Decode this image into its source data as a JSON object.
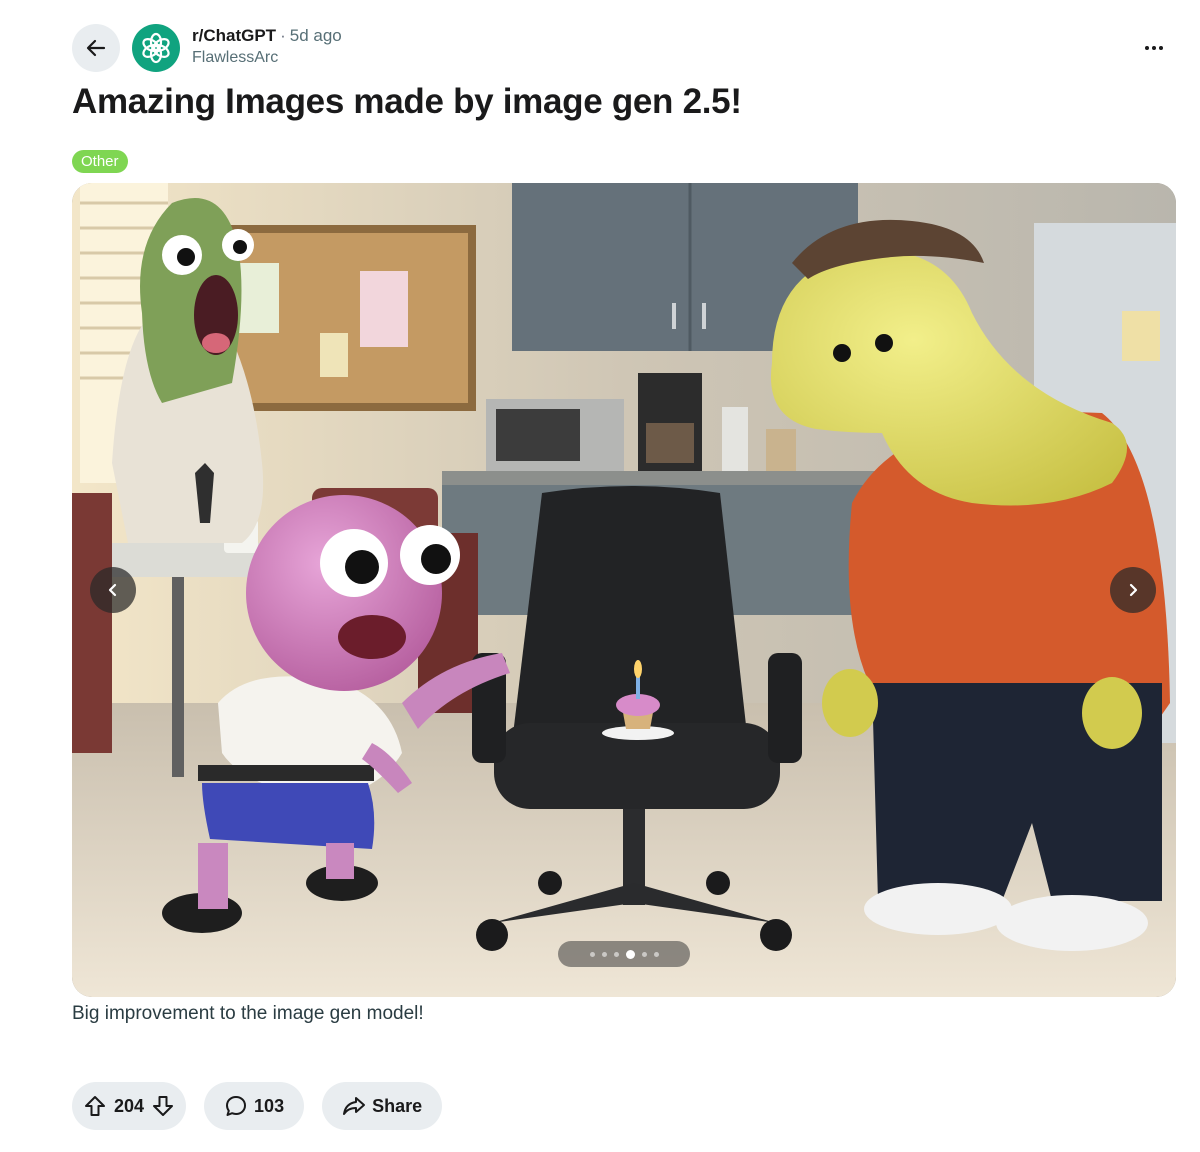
{
  "post": {
    "subreddit": "r/ChatGPT",
    "separator": "·",
    "time_ago": "5d ago",
    "author": "FlawlessArc",
    "title": "Amazing Images made by image gen 2.5!",
    "flair": "Other",
    "caption": "Big improvement to the image gen model!"
  },
  "gallery": {
    "image_description": "3D animated office break room: pink creature reaching toward an office chair holding a cupcake with a lit candle, yellow character in orange hoodie and brown cap, green character screaming in background",
    "slide_count": 6,
    "active_slide": 4
  },
  "actions": {
    "upvotes": "204",
    "comments": "103",
    "share_label": "Share"
  },
  "colors": {
    "accent_avatar": "#10a37f",
    "flair_bg": "#7fd652",
    "pill_bg": "#e9edf0"
  },
  "icons": [
    "back-arrow-icon",
    "openai-logo-icon",
    "more-options-icon",
    "chevron-left-icon",
    "chevron-right-icon",
    "upvote-icon",
    "downvote-icon",
    "comment-icon",
    "share-icon"
  ]
}
